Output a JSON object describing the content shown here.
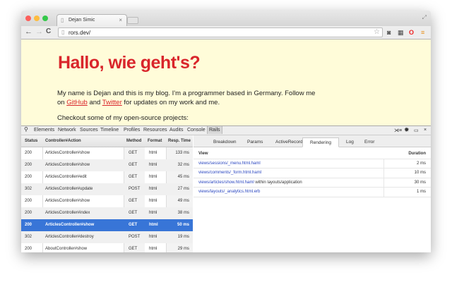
{
  "window": {
    "tab_title": "Dejan Simic",
    "url": "rors.dev/",
    "colors": {
      "close": "#fc605c",
      "minimize": "#fdbc40",
      "zoom": "#34c84a"
    }
  },
  "page": {
    "heading": "Hallo, wie geht's?",
    "intro": "My name is Dejan and this is my blog. I'm a programmer based in Germany. Follow me",
    "line2_pre": "on",
    "github": "GitHub",
    "and": "and",
    "twitter": "Twitter",
    "line2_post": "for updates on my work and me.",
    "projects": "Checkout some of my open-source projects:"
  },
  "devtools": {
    "tabs": [
      "Elements",
      "Network",
      "Sources",
      "Timeline",
      "Profiles",
      "Resources",
      "Audits",
      "Console",
      "Rails"
    ],
    "active_tab": "Rails"
  },
  "requests": {
    "headers": [
      "Status",
      "Controller#Action",
      "Method",
      "Format",
      "Resp. Time"
    ],
    "rows": [
      [
        "200",
        "ArticlesController#show",
        "GET",
        "html",
        "133 ms"
      ],
      [
        "200",
        "ArticlesController#show",
        "GET",
        "html",
        "32 ms"
      ],
      [
        "200",
        "ArticlesController#edit",
        "GET",
        "html",
        "45 ms"
      ],
      [
        "302",
        "ArticlesController#update",
        "POST",
        "html",
        "27 ms"
      ],
      [
        "200",
        "ArticlesController#show",
        "GET",
        "html",
        "49 ms"
      ],
      [
        "200",
        "ArticlesController#index",
        "GET",
        "html",
        "38 ms"
      ],
      [
        "200",
        "ArticlesController#show",
        "GET",
        "html",
        "50 ms"
      ],
      [
        "302",
        "ArticlesController#destroy",
        "POST",
        "html",
        "19 ms"
      ],
      [
        "200",
        "AboutController#show",
        "GET",
        "html",
        "29 ms"
      ]
    ],
    "selected_index": 6
  },
  "detail": {
    "tabs": [
      "Breakdown",
      "Params",
      "ActiveRecord",
      "Rendering",
      "Log",
      "Error"
    ],
    "active_tab": "Rendering",
    "headers": {
      "view": "View",
      "duration": "Duration"
    },
    "rows": [
      {
        "view": "views/sessions/_menu.html.haml",
        "suffix": "",
        "duration": "2 ms"
      },
      {
        "view": "views/comments/_form.html.haml",
        "suffix": "",
        "duration": "10 ms"
      },
      {
        "view": "views/articles/show.html.haml",
        "suffix": "within layouts/application",
        "duration": "30 ms"
      },
      {
        "view": "views/layouts/_analytics.html.erb",
        "suffix": "",
        "duration": "1 ms"
      }
    ]
  }
}
